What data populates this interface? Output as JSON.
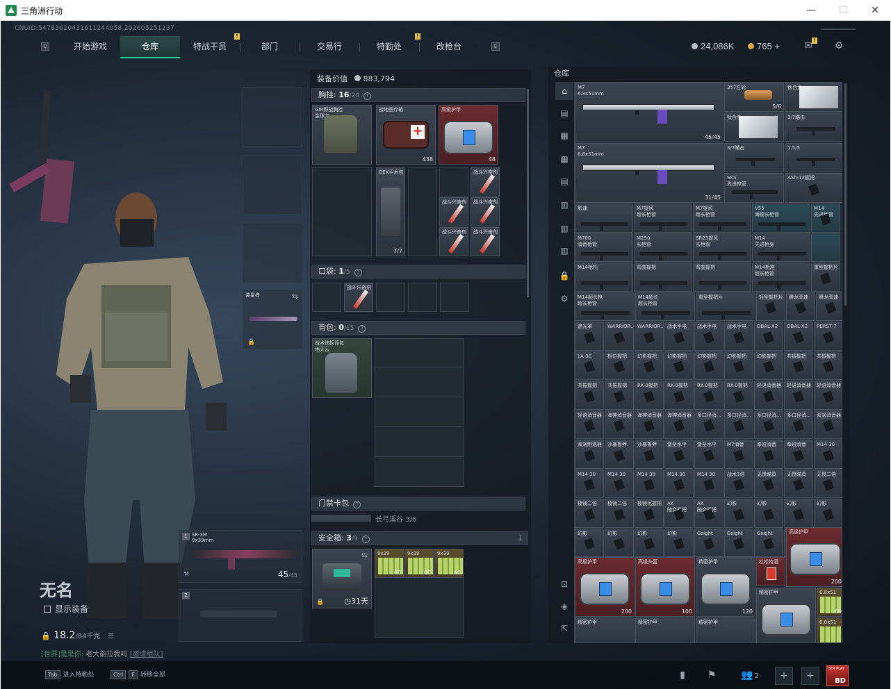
{
  "window": {
    "title": "三角洲行动",
    "minimize": "—",
    "maximize": "☐",
    "close": "✕"
  },
  "uid": "CNUID:54783620431611244058,202605251237",
  "nav": {
    "items": [
      "开始游戏",
      "仓库",
      "特战干员",
      "部门",
      "交易行",
      "特勤处",
      "改枪台"
    ],
    "active": "仓库",
    "left_key": "Q",
    "right_key": "E"
  },
  "currency": {
    "silver": "24,086K",
    "gold": "765",
    "add": "+"
  },
  "character": {
    "name": "无名",
    "show_equipment": "显示装备",
    "weight": "18.2",
    "weight_max": "/84千克"
  },
  "chat": {
    "channel": "[世界]",
    "sender": "是是你:",
    "message": "老大能拉我吗",
    "invite": "[邀请组队]"
  },
  "bottom": {
    "hint1_key": "Tab",
    "hint1": "进入特勤处",
    "hint2_key": "Ctrl",
    "hint2_key2": "F",
    "hint2": "转移全部",
    "squad_count": "2",
    "avatar_label": "BD",
    "avatar_sub": "SE4 PLAY"
  },
  "equip_slots": {
    "secondary_label": "装星者",
    "primary1_index": "1",
    "primary1_name": "SR-3M",
    "primary1_caliber": "9x39mm",
    "primary1_ammo": "45",
    "primary1_ammo_max": "/45",
    "primary2_index": "2"
  },
  "equipment_value": {
    "label": "装备价值",
    "value": "883,794"
  },
  "rig": {
    "title": "胸挂:",
    "count": "16",
    "max": "/20",
    "items": [
      {
        "label": "GIR野战胸挂\n金球力"
      },
      {
        "label": "战地医疗箱",
        "qty": "438"
      },
      {
        "label": "高级护甲",
        "qty": "48"
      },
      {
        "label": "DEK手术包",
        "qty": "7/7"
      },
      {
        "label": "战斗兴奋剂"
      },
      {
        "label": "战斗兴奋剂"
      },
      {
        "label": "战斗兴奋剂"
      },
      {
        "label": "战斗兴奋剂"
      },
      {
        "label": "战斗兴奋剂"
      },
      {
        "label": "战斗兴奋剂"
      }
    ]
  },
  "pocket": {
    "title": "口袋:",
    "count": "1",
    "max": "/5",
    "item": "战斗兴奋剂"
  },
  "backpack": {
    "title": "背包:",
    "count": "0",
    "max": "/15",
    "item": "战术快拆背包\n地天云"
  },
  "keycard": {
    "title": "门禁卡包",
    "sub": "长弓溪谷 3/6"
  },
  "safebox": {
    "title": "安全箱:",
    "count": "3",
    "max": "/9",
    "days": "31天",
    "items": [
      {
        "label": "9x39",
        "qty": "60"
      },
      {
        "label": "9x39",
        "qty": "60"
      },
      {
        "label": "9x39",
        "qty": "60"
      }
    ]
  },
  "warehouse": {
    "title": "仓库",
    "top_items": [
      {
        "label": "M7\n6.8x51mm",
        "qty": "45/45"
      },
      {
        "label": "357左轮",
        "qty": "5/6"
      },
      {
        "label": "钛合金"
      },
      {
        "label": "M7\n6.8x51mm",
        "qty": "31/45"
      },
      {
        "label": "钛合金"
      },
      {
        "label": "3/7瞄击"
      },
      {
        "label": "3/7瞄击"
      },
      {
        "label": "1.5/5"
      },
      {
        "label": "SKS\n先进枪管"
      },
      {
        "label": "ASh-12握把"
      }
    ],
    "grid": [
      [
        "影速",
        "M7提风\n超长枪管",
        "M7提风\n超长枪管",
        "V55\n海德长枪管",
        "M14\n先进枪管"
      ],
      [
        "M700\n消音枪管",
        "M250\n长枪管",
        "SR25提风\n长枪管",
        "M14\n先进枪身",
        ""
      ],
      [
        "M14枪托",
        "弯曲握把",
        "弯曲握把",
        "M14枪座\n超长枪管",
        "重型握把片"
      ],
      [
        "M14超长枪\n超长枪管",
        "M14超长\n超长枪管",
        "重型握把片",
        "轻型握把片",
        "腾龙高速",
        "腾龙高速",
        "腾龙高速"
      ],
      [
        "遮光罩",
        "WARRIOR...",
        "WARRIOR...",
        "战术手电",
        "战术手电",
        "战术手电",
        "DBAL-X2",
        "DBAL-X2",
        "PERST-7"
      ],
      [
        "LA-3C",
        "相位握把",
        "幻影握把",
        "幻影握把",
        "幻影握把",
        "幻影握把",
        "幻影握把",
        "共振握把",
        "共振握把"
      ],
      [
        "共振握把",
        "共振握把",
        "RK-0握把",
        "RK-0握把",
        "RK-0握把",
        "RK-0握把",
        "轻语消音器",
        "轻语消音器",
        "轻语消音器"
      ],
      [
        "轻语消音器",
        "海神消音器",
        "海神消音器",
        "海神消音器",
        "多口径消...",
        "多口径消...",
        "多口径消...",
        "多口径消...",
        "双涡消音器"
      ],
      [
        "双涡制退器",
        "沙暴鲁莽",
        "沙暴鲁莽",
        "堡垒水平",
        "堡垒水平",
        "M7消音",
        "奉班消音",
        "奉班消音",
        "M14 30"
      ],
      [
        "M14 30",
        "M14 30",
        "M14 30",
        "M14 30",
        "M14 30",
        "战术3倍",
        "无畏瞄具",
        "无畏瞄具",
        "无畏二倍"
      ],
      [
        "棱镜二倍",
        "棱镜二倍",
        "棱镜化握把",
        "AK\n随变握把",
        "AK\n随变握把",
        "幻影",
        "幻影",
        "幻影",
        "幻影"
      ],
      [
        "幻影",
        "幻影",
        "幻影",
        "幻影",
        "Gsight",
        "Gsight",
        "Gsight",
        "",
        ""
      ]
    ],
    "armor_row": [
      {
        "label": "高级护甲",
        "qty": "200"
      },
      {
        "label": "高级头盔",
        "qty": "100"
      },
      {
        "label": "精密护甲",
        "qty": "120"
      },
      {
        "label": "杜松特酒"
      },
      {
        "label": "高级护甲",
        "qty": "200"
      }
    ],
    "last_row": [
      {
        "label": "精密护甲"
      },
      {
        "label": "精密护甲"
      },
      {
        "label": "精密护甲"
      },
      {
        "label": "精密护甲"
      },
      {
        "label": "6.8x51",
        "qty": "60"
      },
      {
        "label": "6.8x51",
        "qty": "60"
      }
    ]
  }
}
